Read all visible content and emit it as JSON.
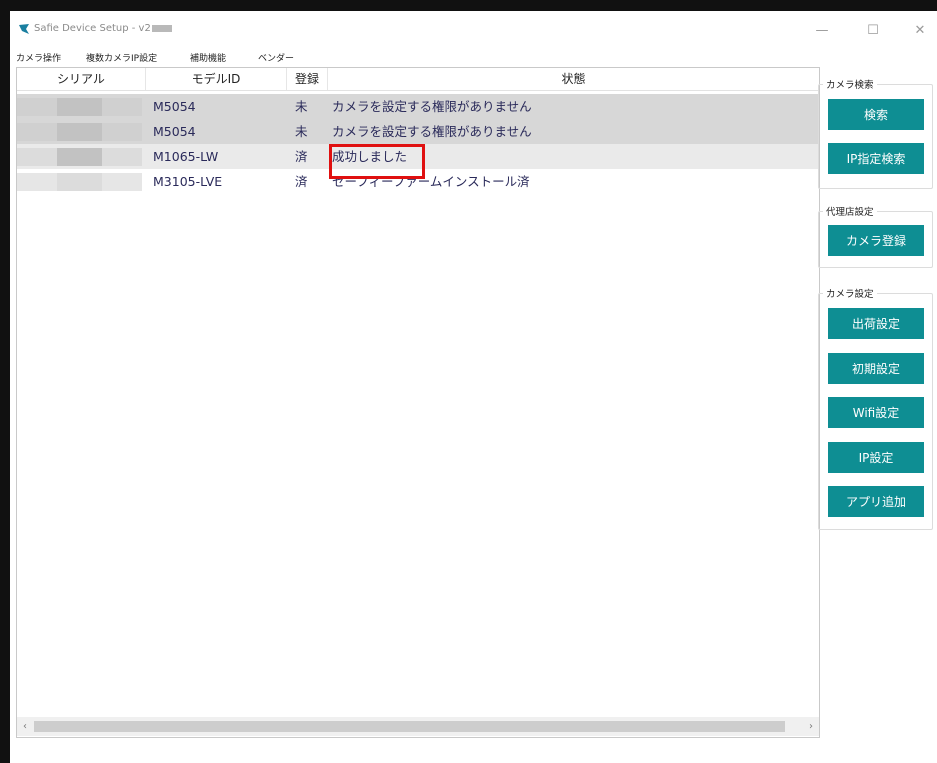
{
  "window": {
    "title": "Safie Device Setup - v2",
    "controls": {
      "minimize": "—",
      "maximize": "☐",
      "close": "✕"
    }
  },
  "menubar": {
    "items": [
      "カメラ操作",
      "複数カメラIP設定",
      "補助機能",
      "ベンダー"
    ]
  },
  "table": {
    "columns": [
      "シリアル",
      "モデルID",
      "登録",
      "状態"
    ],
    "rows": [
      {
        "serial": "",
        "model": "M5054",
        "registered": "未",
        "status": "カメラを設定する権限がありません"
      },
      {
        "serial": "",
        "model": "M5054",
        "registered": "未",
        "status": "カメラを設定する権限がありません"
      },
      {
        "serial": "",
        "model": "M1065-LW",
        "registered": "済",
        "status": "成功しました"
      },
      {
        "serial": "",
        "model": "M3105-LVE",
        "registered": "済",
        "status": "セーフィーファームインストール済"
      }
    ]
  },
  "scrollbar": {
    "left_arrow": "‹",
    "right_arrow": "›"
  },
  "sidebar": {
    "camera_search": {
      "title": "カメラ検索",
      "search": "検索",
      "ip_search": "IP指定検索"
    },
    "agency": {
      "title": "代理店設定",
      "register": "カメラ登録"
    },
    "camera_settings": {
      "title": "カメラ設定",
      "shipping": "出荷設定",
      "initial": "初期設定",
      "wifi": "Wifi設定",
      "ip": "IP設定",
      "add_app": "アプリ追加"
    }
  },
  "colors": {
    "accent": "#0e8e93",
    "highlight": "#e01010",
    "row_text": "#2a2a5a"
  }
}
